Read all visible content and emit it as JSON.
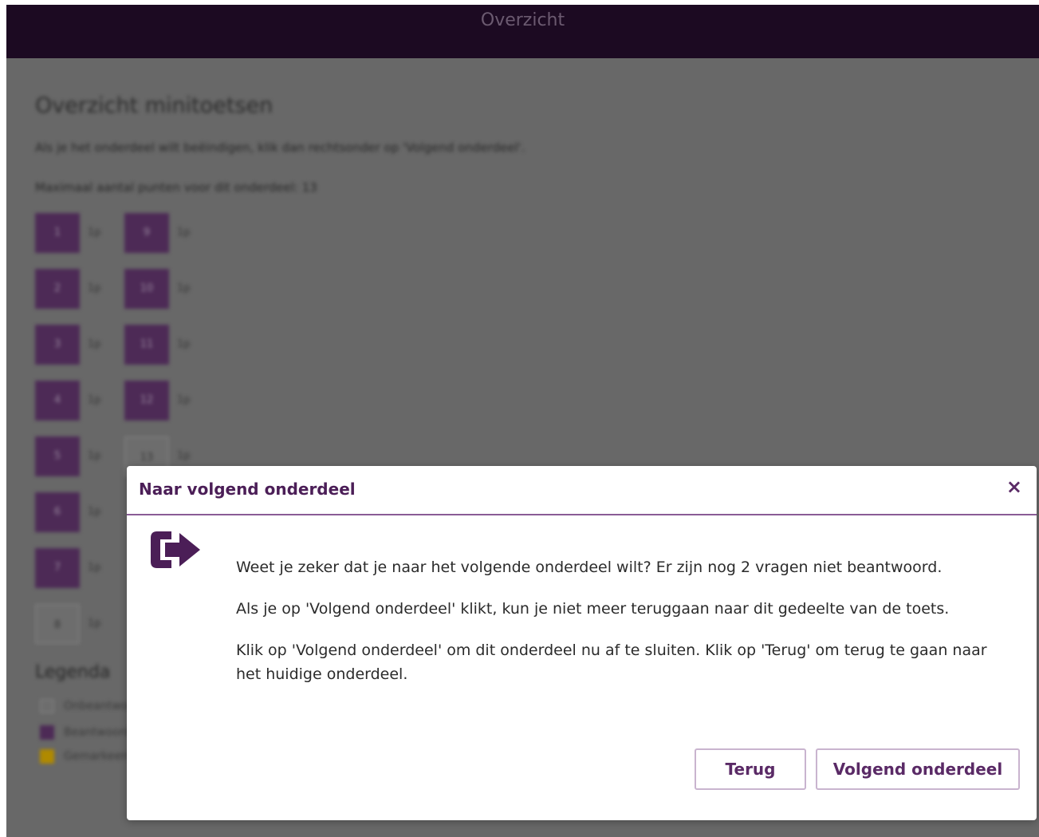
{
  "header": {
    "title": "Overzicht"
  },
  "background": {
    "title": "Overzicht minitoetsen",
    "instruction": "Als je het onderdeel wilt beëindigen, klik dan rechtsonder op 'Volgend onderdeel'.",
    "max_points": "Maximaal aantal punten voor dit onderdeel: 13",
    "points_suffix": "1p",
    "questions_col1": [
      "1",
      "2",
      "3",
      "4",
      "5",
      "6",
      "7",
      "8"
    ],
    "questions_col2": [
      "9",
      "10",
      "11",
      "12",
      "13"
    ],
    "legend": {
      "title": "Legenda",
      "items": [
        "Onbeantwoord",
        "Beantwoord",
        "Gemarkeerd"
      ]
    }
  },
  "modal": {
    "title": "Naar volgend onderdeel",
    "close_symbol": "×",
    "icon": "sign-out-arrow-icon",
    "paragraphs": [
      "Weet je zeker dat je naar het volgende onderdeel wilt? Er zijn nog 2 vragen niet beantwoord.",
      "Als je op 'Volgend onderdeel' klikt, kun je niet meer teruggaan naar dit gedeelte van de toets.",
      "Klik op 'Volgend onderdeel' om dit onderdeel nu af te sluiten. Klik op 'Terug' om terug te gaan naar het huidige onderdeel."
    ],
    "back_label": "Terug",
    "next_label": "Volgend onderdeel"
  },
  "colors": {
    "accent": "#5a2a66",
    "header_bg": "#1c0a22",
    "answered": "#4d2a56",
    "marked": "#b08a00"
  }
}
